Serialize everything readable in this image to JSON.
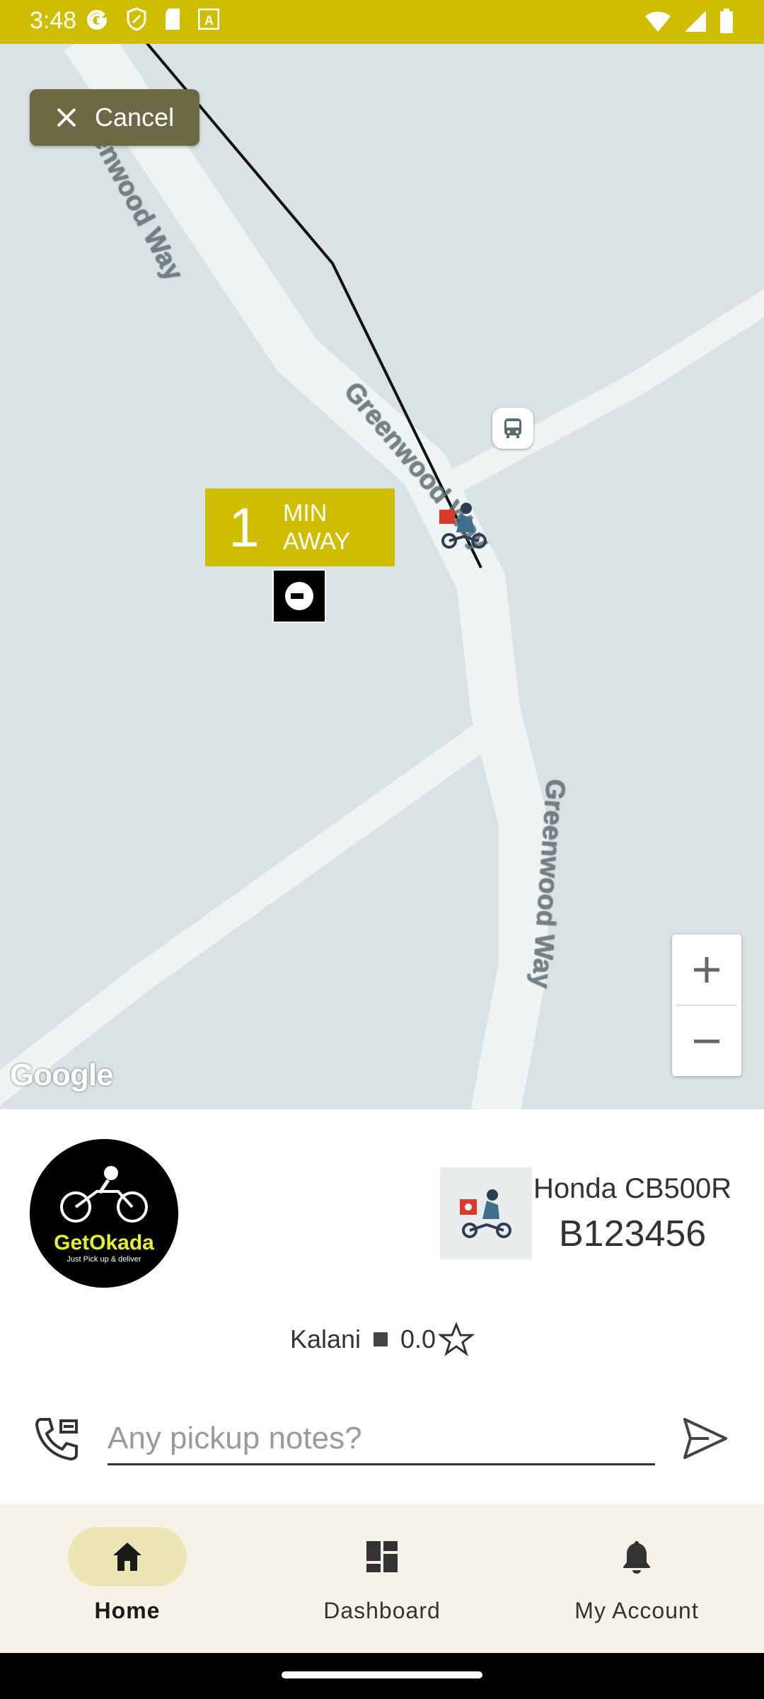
{
  "status_bar": {
    "time": "3:48"
  },
  "map": {
    "cancel_label": "Cancel",
    "eta": {
      "number": "1",
      "line1": "MIN",
      "line2": "AWAY"
    },
    "street_name": "Greenwood Way",
    "attribution": "Google",
    "zoom_in": "+",
    "zoom_out": "−"
  },
  "trip": {
    "logo": {
      "brand": "GetOkada",
      "tagline": "Just Pick up & deliver"
    },
    "vehicle_model": "Honda CB500R",
    "plate": "B123456",
    "driver_name": "Kalani",
    "rating": "0.0",
    "notes_placeholder": "Any pickup notes?"
  },
  "bottom_nav": {
    "items": [
      {
        "label": "Home",
        "icon": "home-icon",
        "active": true
      },
      {
        "label": "Dashboard",
        "icon": "dashboard-icon",
        "active": false
      },
      {
        "label": "My Account",
        "icon": "bell-icon",
        "active": false
      }
    ]
  },
  "colors": {
    "accent": "#cfbd00",
    "cancel_bg": "#6b6a44",
    "nav_bg": "#f6f2e8",
    "nav_active_pill": "#ece5b4"
  }
}
